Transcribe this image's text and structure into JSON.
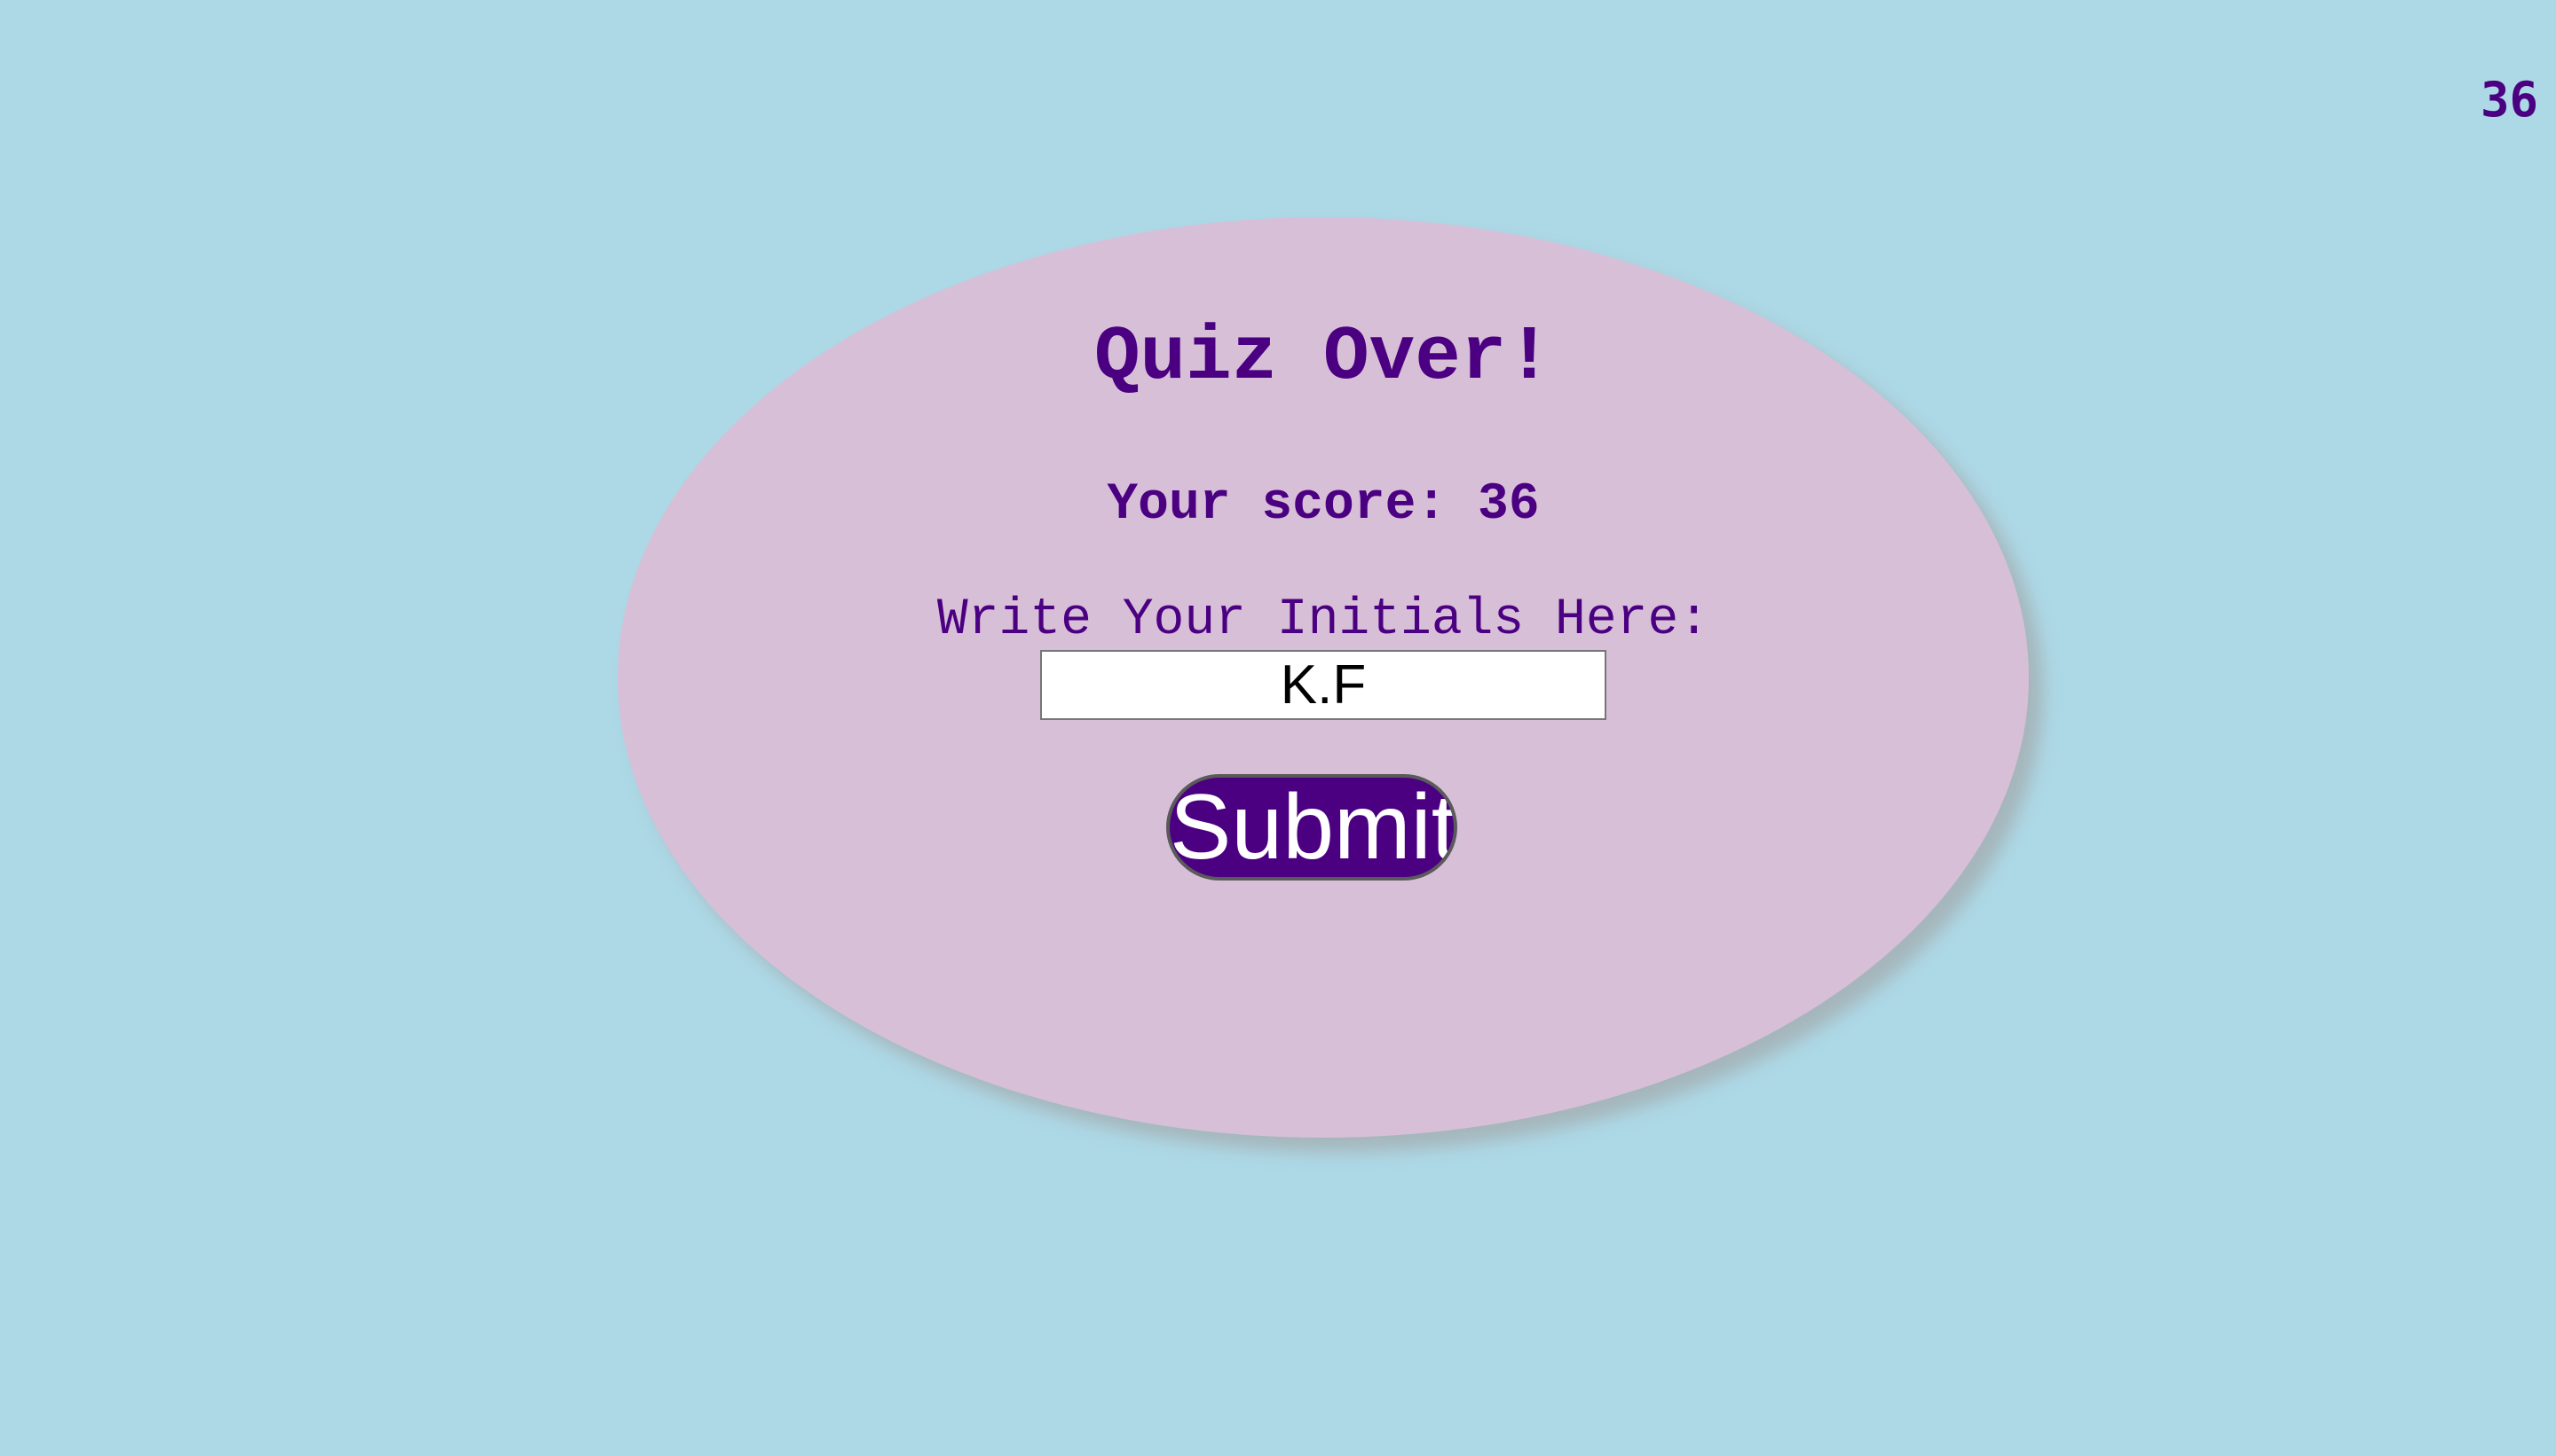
{
  "timer": {
    "value": "36"
  },
  "quiz_end": {
    "title": "Quiz Over!",
    "score_label": "Your score:",
    "score_value": "36",
    "initials_label": "Write Your Initials Here:",
    "initials_value": "K.F",
    "submit_label": "Submit"
  },
  "colors": {
    "background": "#add8e6",
    "card": "#d8bfd8",
    "accent": "#4b0082",
    "button_text": "#ffffff"
  }
}
